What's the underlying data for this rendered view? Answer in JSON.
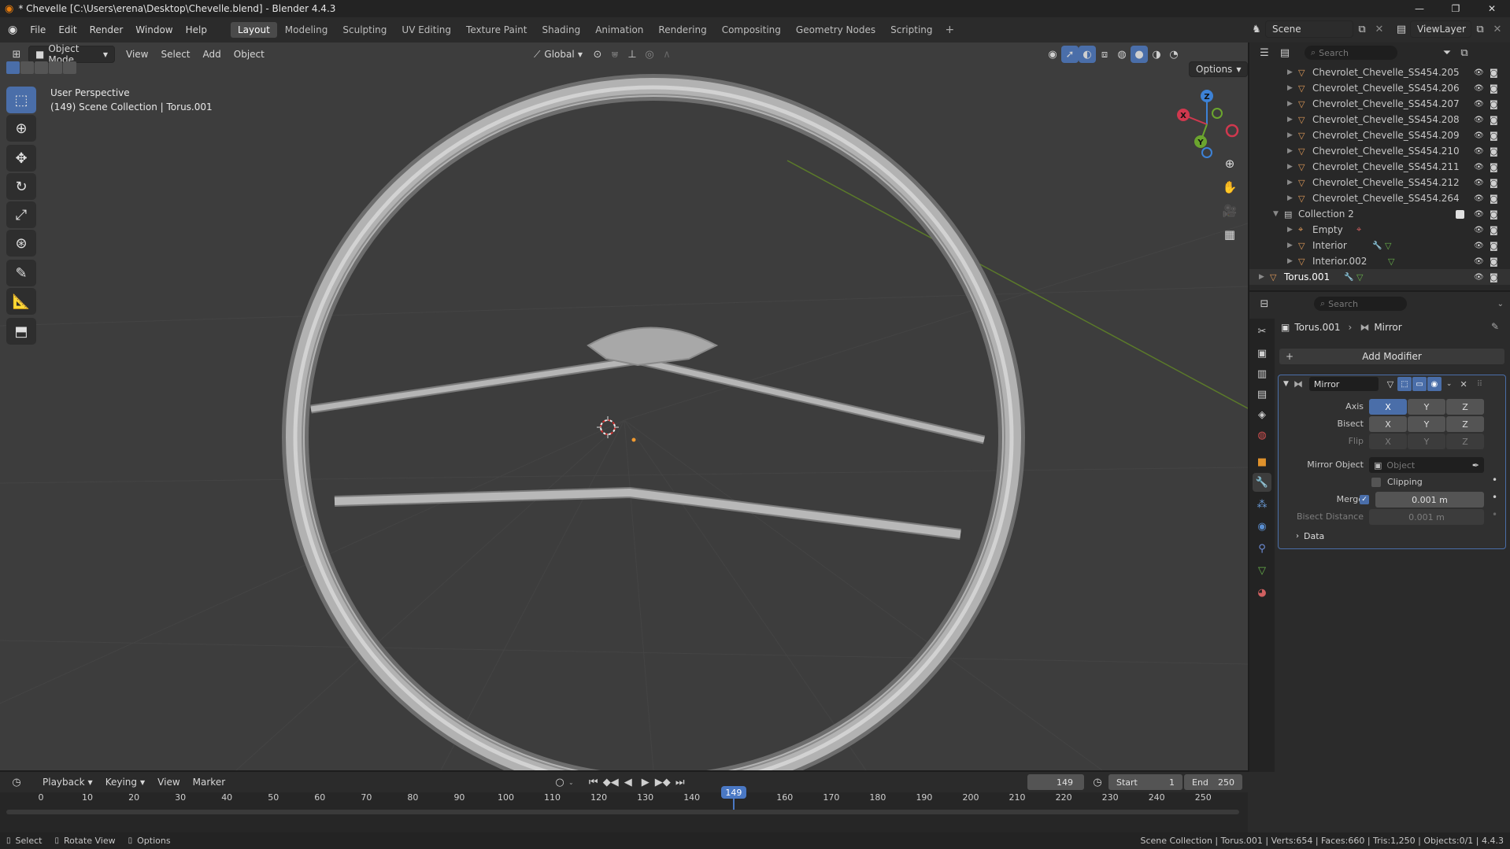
{
  "window": {
    "title": "* Chevelle [C:\\Users\\erena\\Desktop\\Chevelle.blend] - Blender 4.4.3"
  },
  "menu": [
    "File",
    "Edit",
    "Render",
    "Window",
    "Help"
  ],
  "workspaces": [
    {
      "label": "Layout",
      "active": true
    },
    {
      "label": "Modeling"
    },
    {
      "label": "Sculpting"
    },
    {
      "label": "UV Editing"
    },
    {
      "label": "Texture Paint"
    },
    {
      "label": "Shading"
    },
    {
      "label": "Animation"
    },
    {
      "label": "Rendering"
    },
    {
      "label": "Compositing"
    },
    {
      "label": "Geometry Nodes"
    },
    {
      "label": "Scripting"
    }
  ],
  "topright": {
    "scene": "Scene",
    "view_layer": "ViewLayer"
  },
  "viewport": {
    "mode": "Object Mode",
    "menus": [
      "View",
      "Select",
      "Add",
      "Object"
    ],
    "orientation": "Global",
    "options_label": "Options",
    "info_line1": "User Perspective",
    "info_line2": "(149) Scene Collection | Torus.001"
  },
  "gizmo": {
    "z": "Z",
    "y": "Y",
    "x": "X"
  },
  "outliner": {
    "search_placeholder": "Search",
    "rows": [
      {
        "label": "Chevrolet_Chevelle_SS454.205",
        "type": "mesh",
        "indent": 2
      },
      {
        "label": "Chevrolet_Chevelle_SS454.206",
        "type": "mesh",
        "indent": 2
      },
      {
        "label": "Chevrolet_Chevelle_SS454.207",
        "type": "mesh",
        "indent": 2
      },
      {
        "label": "Chevrolet_Chevelle_SS454.208",
        "type": "mesh",
        "indent": 2
      },
      {
        "label": "Chevrolet_Chevelle_SS454.209",
        "type": "mesh",
        "indent": 2
      },
      {
        "label": "Chevrolet_Chevelle_SS454.210",
        "type": "mesh",
        "indent": 2
      },
      {
        "label": "Chevrolet_Chevelle_SS454.211",
        "type": "mesh",
        "indent": 2
      },
      {
        "label": "Chevrolet_Chevelle_SS454.212",
        "type": "mesh",
        "indent": 2
      },
      {
        "label": "Chevrolet_Chevelle_SS454.264",
        "type": "mesh",
        "indent": 2
      },
      {
        "label": "Collection 2",
        "type": "collection",
        "indent": 1
      },
      {
        "label": "Empty",
        "type": "empty",
        "indent": 2
      },
      {
        "label": "Interior",
        "type": "mesh",
        "indent": 2
      },
      {
        "label": "Interior.002",
        "type": "mesh",
        "indent": 2
      },
      {
        "label": "Torus.001",
        "type": "mesh",
        "indent": 0,
        "selected": true
      }
    ]
  },
  "properties": {
    "search_placeholder": "Search",
    "breadcrumb_object": "Torus.001",
    "breadcrumb_modifier": "Mirror",
    "add_modifier": "Add Modifier",
    "modifier_name": "Mirror",
    "axis_label": "Axis",
    "bisect_label": "Bisect",
    "flip_label": "Flip",
    "xyz": [
      "X",
      "Y",
      "Z"
    ],
    "mirror_object_label": "Mirror Object",
    "mirror_object_placeholder": "Object",
    "clipping_label": "Clipping",
    "merge_label": "Merge",
    "merge_value": "0.001 m",
    "bisect_distance_label": "Bisect Distance",
    "bisect_distance_value": "0.001 m",
    "data_label": "Data"
  },
  "timeline": {
    "menus": [
      "Playback",
      "Keying",
      "View",
      "Marker"
    ],
    "current_frame": "149",
    "start_label": "Start",
    "start": "1",
    "end_label": "End",
    "end": "250",
    "ticks": [
      "0",
      "10",
      "20",
      "30",
      "40",
      "50",
      "60",
      "70",
      "80",
      "90",
      "100",
      "110",
      "120",
      "130",
      "140",
      "160",
      "170",
      "180",
      "190",
      "200",
      "210",
      "220",
      "230",
      "240",
      "250"
    ]
  },
  "status": {
    "select": "Select",
    "rotate": "Rotate View",
    "options": "Options",
    "stats": "Scene Collection | Torus.001 | Verts:654 | Faces:660 | Tris:1,250 | Objects:0/1 | 4.4.3"
  }
}
